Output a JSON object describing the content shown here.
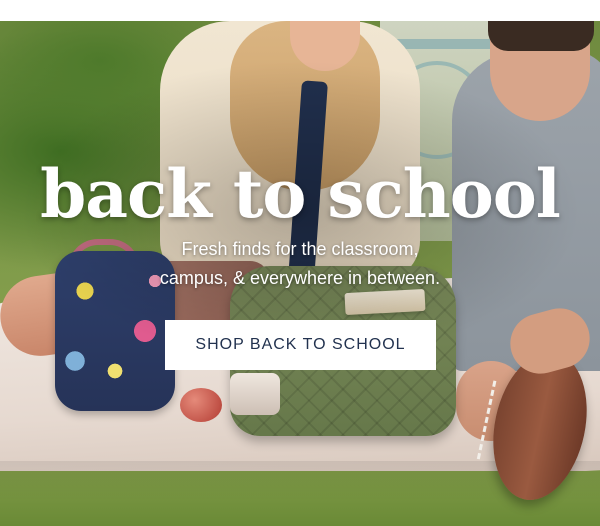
{
  "hero": {
    "headline": "back to school",
    "subhead_line1": "Fresh finds for the classroom,",
    "subhead_line2": "campus, & everywhere in between.",
    "cta_label": "SHOP BACK TO SCHOOL"
  },
  "colors": {
    "text": "#ffffff",
    "cta_background": "#ffffff",
    "cta_text": "#22324f"
  }
}
